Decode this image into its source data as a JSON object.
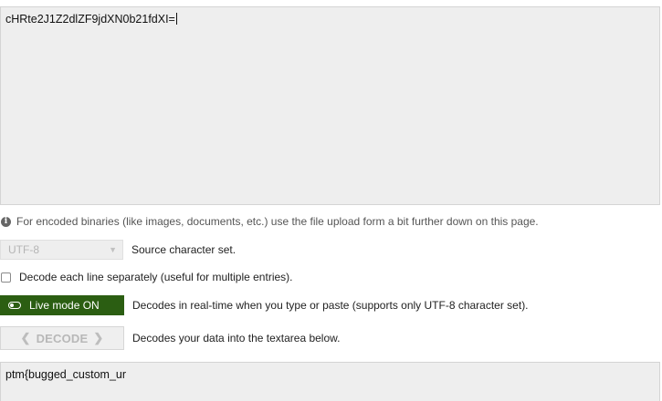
{
  "input": {
    "value": "cHRte2J1Z2dlZF9jdXN0b21fdXI="
  },
  "hint": {
    "icon": "info-icon",
    "text": "For encoded binaries (like images, documents, etc.) use the file upload form a bit further down on this page."
  },
  "charset": {
    "selected": "UTF-8",
    "label": "Source character set."
  },
  "line_mode": {
    "checked": false,
    "label": "Decode each line separately (useful for multiple entries)."
  },
  "live_mode": {
    "button_label": "Live mode ON",
    "description": "Decodes in real-time when you type or paste (supports only UTF-8 character set).",
    "color": "#2b5e12"
  },
  "decode": {
    "button_label": "DECODE",
    "description": "Decodes your data into the textarea below."
  },
  "output": {
    "value": "ptm{bugged_custom_ur"
  }
}
